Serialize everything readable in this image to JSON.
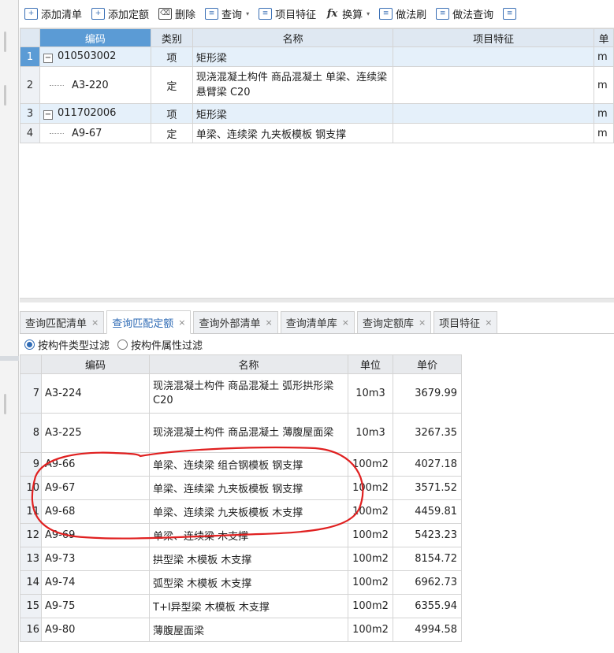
{
  "toolbar": [
    {
      "icon": "add-bill-icon",
      "label": "添加清单",
      "caret": false
    },
    {
      "icon": "add-quota-icon",
      "label": "添加定额",
      "caret": false
    },
    {
      "icon": "delete-icon",
      "label": "删除",
      "caret": false
    },
    {
      "icon": "query-icon",
      "label": "查询",
      "caret": true
    },
    {
      "icon": "item-feature-icon",
      "label": "项目特征",
      "caret": false
    },
    {
      "icon": "fx-icon",
      "label": "换算",
      "caret": true
    },
    {
      "icon": "brush-icon",
      "label": "做法刷",
      "caret": false
    },
    {
      "icon": "method-query-icon",
      "label": "做法查询",
      "caret": false
    },
    {
      "icon": "more-icon",
      "label": "",
      "caret": false
    }
  ],
  "top_table": {
    "headers": {
      "code": "编码",
      "type": "类别",
      "name": "名称",
      "feature": "项目特征",
      "unit": "单"
    },
    "rows": [
      {
        "idx": "1",
        "code": "010503002",
        "type": "项",
        "name": "矩形梁",
        "feature": "",
        "unit": "m",
        "level": 0,
        "selected": true
      },
      {
        "idx": "2",
        "code": "A3-220",
        "type": "定",
        "name": "现浇混凝土构件 商品混凝土 单梁、连续梁悬臂梁 C20",
        "feature": "",
        "unit": "m",
        "level": 1,
        "selected": false
      },
      {
        "idx": "3",
        "code": "011702006",
        "type": "项",
        "name": "矩形梁",
        "feature": "",
        "unit": "m",
        "level": 0,
        "selected": false
      },
      {
        "idx": "4",
        "code": "A9-67",
        "type": "定",
        "name": "单梁、连续梁 九夹板模板 钢支撑",
        "feature": "",
        "unit": "m",
        "level": 1,
        "selected": false
      }
    ]
  },
  "tabs": [
    {
      "label": "查询匹配清单",
      "active": false
    },
    {
      "label": "查询匹配定额",
      "active": true
    },
    {
      "label": "查询外部清单",
      "active": false
    },
    {
      "label": "查询清单库",
      "active": false
    },
    {
      "label": "查询定额库",
      "active": false
    },
    {
      "label": "项目特征",
      "active": false
    }
  ],
  "filters": [
    {
      "label": "按构件类型过滤",
      "checked": true
    },
    {
      "label": "按构件属性过滤",
      "checked": false
    }
  ],
  "bottom_table": {
    "headers": {
      "code": "编码",
      "name": "名称",
      "unit": "单位",
      "price": "单价"
    },
    "rows": [
      {
        "idx": "7",
        "code": "A3-224",
        "name": "现浇混凝土构件 商品混凝土 弧形拱形梁 C20",
        "unit": "10m3",
        "price": "3679.99",
        "tall": true
      },
      {
        "idx": "8",
        "code": "A3-225",
        "name": "现浇混凝土构件 商品混凝土 薄腹屋面梁",
        "unit": "10m3",
        "price": "3267.35",
        "tall": true
      },
      {
        "idx": "9",
        "code": "A9-66",
        "name": "单梁、连续梁 组合钢模板 钢支撑",
        "unit": "100m2",
        "price": "4027.18",
        "tall": false
      },
      {
        "idx": "10",
        "code": "A9-67",
        "name": "单梁、连续梁 九夹板模板 钢支撑",
        "unit": "100m2",
        "price": "3571.52",
        "tall": false
      },
      {
        "idx": "11",
        "code": "A9-68",
        "name": "单梁、连续梁 九夹板模板 木支撑",
        "unit": "100m2",
        "price": "4459.81",
        "tall": false
      },
      {
        "idx": "12",
        "code": "A9-69",
        "name": "单梁、连续梁 木支撑",
        "unit": "100m2",
        "price": "5423.23",
        "tall": false
      },
      {
        "idx": "13",
        "code": "A9-73",
        "name": "拱型梁 木模板 木支撑",
        "unit": "100m2",
        "price": "8154.72",
        "tall": false
      },
      {
        "idx": "14",
        "code": "A9-74",
        "name": "弧型梁 木模板 木支撑",
        "unit": "100m2",
        "price": "6962.73",
        "tall": false
      },
      {
        "idx": "15",
        "code": "A9-75",
        "name": "T+I异型梁 木模板 木支撑",
        "unit": "100m2",
        "price": "6355.94",
        "tall": false
      },
      {
        "idx": "16",
        "code": "A9-80",
        "name": "薄腹屋面梁",
        "unit": "100m2",
        "price": "4994.58",
        "tall": false
      }
    ]
  },
  "annotation_color": "#e02020"
}
